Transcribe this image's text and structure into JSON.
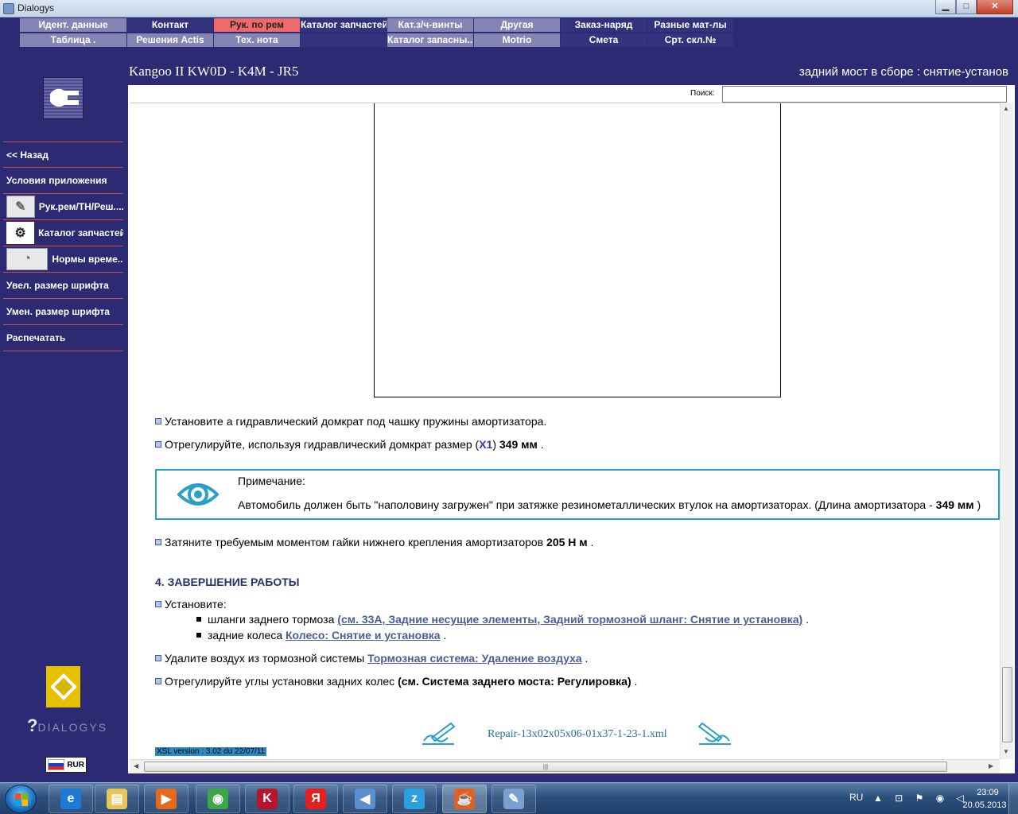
{
  "window": {
    "title": "Dialogys",
    "minimize_glyph": "▁",
    "maximize_glyph": "□",
    "close_glyph": "✕"
  },
  "topmenu": {
    "row1": [
      "Идент. данные",
      "Контакт",
      "Рук. по рем",
      "Каталог запчастей",
      "Кат.з/ч-винты",
      "Другая",
      "Заказ-наряд",
      "Разные мат-лы"
    ],
    "row2": [
      "Таблица .",
      "Решения Actis",
      "Тех. нота",
      "",
      "Каталог запасны...",
      "Motrio",
      "Смета",
      "Срт. скл.№"
    ],
    "active": "Рук. по рем",
    "colors": {
      "light": "#8585b5",
      "dark": "#33337d",
      "active": "#f06a6a"
    }
  },
  "header": {
    "vehicle": "Kangoo II KW0D - K4M - JR5",
    "procedure": "задний мост в сборе : снятие-установ"
  },
  "sidebar": {
    "items": [
      {
        "label": "<< Назад",
        "icon": ""
      },
      {
        "label": "Условия приложения",
        "icon": ""
      },
      {
        "label": "Рук.рем/ТН/Реш....",
        "icon": "wrench-thumbnail-icon"
      },
      {
        "label": "Каталог запчастей",
        "icon": "parts-thumbnail-icon"
      },
      {
        "label": "Нормы време...",
        "icon": "gauge-thumbnail-icon"
      },
      {
        "label": "Увел. размер шрифта",
        "icon": ""
      },
      {
        "label": "Умен. размер шрифта",
        "icon": ""
      },
      {
        "label": "Распечатать",
        "icon": ""
      }
    ],
    "brand_text": "DIALOGYS",
    "currency": "RUR"
  },
  "search": {
    "label": "Поиск:",
    "value": "",
    "placeholder": ""
  },
  "doc": {
    "step1": "Установите а гидравлический домкрат под чашку пружины амортизатора.",
    "step2_pre": "Отрегулируйте, используя гидравлический домкрат размер (",
    "step2_ref": "X1",
    "step2_mid": ") ",
    "step2_val": "349 мм",
    "step2_post": " .",
    "note_title": "Примечание:",
    "note_pre": "Автомобиль должен быть \"наполовину загружен\" при затяжке резинометаллических втулок на амортизаторах. (Длина амортизатора - ",
    "note_val": "349 мм",
    "note_post": " )",
    "step3_pre": "Затяните требуемым моментом гайки нижнего крепления амортизаторов ",
    "step3_val": "205 Н м",
    "step3_post": " .",
    "section": "4. ЗАВЕРШЕНИЕ РАБОТЫ",
    "step4": "Установите:",
    "sub1_pre": "шланги заднего тормоза ",
    "sub1_link": "(см. 33А, Задние несущие элементы, Задний тормозной шланг: Снятие и установка)",
    "sub1_post": " .",
    "sub2_pre": "задние колеса ",
    "sub2_link": "Колесо: Снятие и установка",
    "sub2_post": " .",
    "step5_pre": "Удалите воздух из тормозной системы ",
    "step5_link": "Тормозная система: Удаление воздуха",
    "step5_post": " .",
    "step6_pre": "Отрегулируйте углы установки задних колес ",
    "step6_val": "(см. Система заднего моста: Регулировка)",
    "step6_post": " .",
    "filename": "Repair-13x02x05x06-01x37-1-23-1.xml",
    "xsl": "XSL version : 3.02 du 22/07/11"
  },
  "taskbar": {
    "apps": [
      {
        "name": "internet-explorer",
        "glyph": "e",
        "color": "#1e7ad6"
      },
      {
        "name": "file-explorer",
        "glyph": "▤",
        "color": "#e8c55a"
      },
      {
        "name": "media-player",
        "glyph": "▶",
        "color": "#e56a1a"
      },
      {
        "name": "chrome",
        "glyph": "◉",
        "color": "#3aa845"
      },
      {
        "name": "kaspersky",
        "glyph": "K",
        "color": "#b8152a"
      },
      {
        "name": "yandex",
        "glyph": "Я",
        "color": "#e62020"
      },
      {
        "name": "audio",
        "glyph": "◀",
        "color": "#5a90d0"
      },
      {
        "name": "zona",
        "glyph": "z",
        "color": "#2aa0e0"
      },
      {
        "name": "java",
        "glyph": "☕",
        "color": "#e06020"
      },
      {
        "name": "paint",
        "glyph": "✎",
        "color": "#7aa0d0"
      }
    ],
    "lang": "RU",
    "tray_icons": "▲ ⊡ ⚑ ◉ ◁",
    "time": "23:09",
    "date": "20.05.2013"
  }
}
